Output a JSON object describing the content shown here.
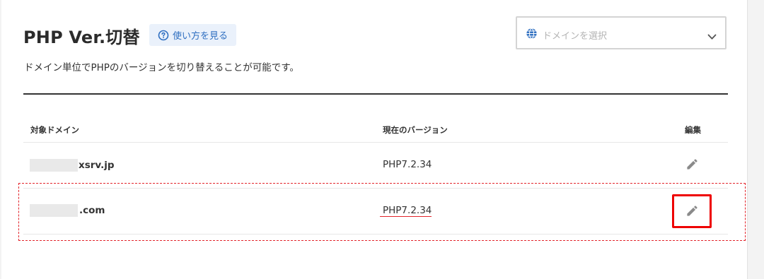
{
  "page": {
    "title": "PHP Ver.切替",
    "help_label": "使い方を見る",
    "description": "ドメイン単位でPHPのバージョンを切り替えることが可能です。"
  },
  "domain_select": {
    "placeholder": "ドメインを選択",
    "icon": "globe-icon",
    "dropdown_icon": "chevron-down-icon"
  },
  "table": {
    "headers": {
      "domain": "対象ドメイン",
      "version": "現在のバージョン",
      "edit": "編集"
    },
    "rows": [
      {
        "domain": "xsrv.jp",
        "version": "PHP7.2.34",
        "edit_icon": "pencil-icon"
      },
      {
        "domain": ".com",
        "version": "PHP7.2.34",
        "edit_icon": "pencil-icon"
      }
    ]
  },
  "colors": {
    "accent_blue": "#2f6fc1",
    "help_bg": "#eaf1fb",
    "highlight_red": "#e3242b",
    "focus_red": "#ee0000"
  }
}
